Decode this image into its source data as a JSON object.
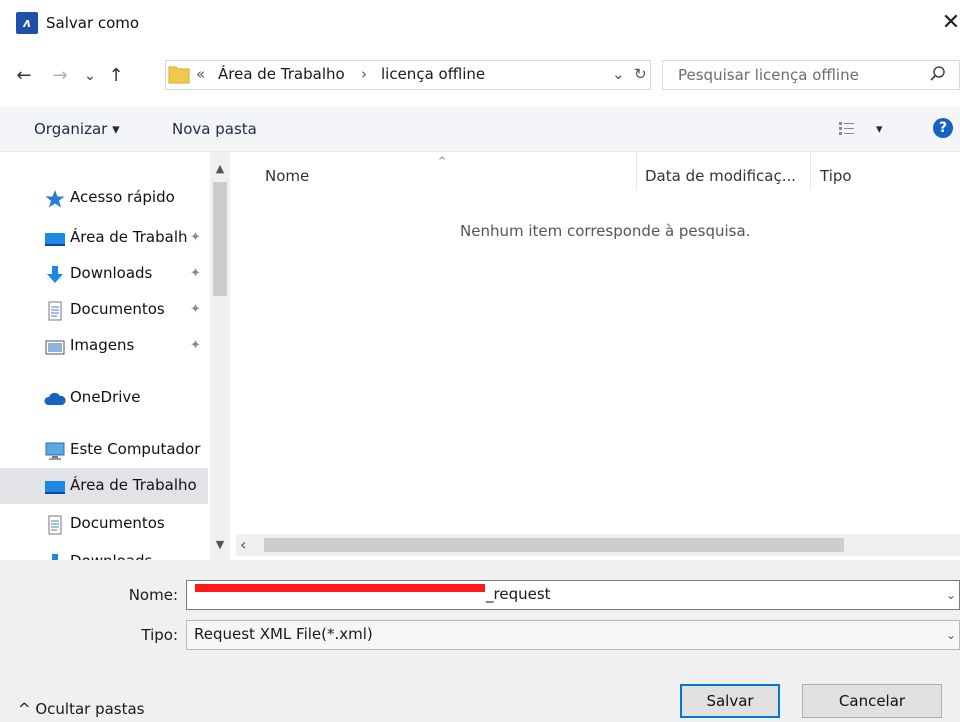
{
  "window": {
    "title": "Salvar como",
    "close_glyph": "✕"
  },
  "nav": {
    "back": "←",
    "forward": "→",
    "recent": "⌄",
    "up": "↑"
  },
  "address": {
    "overflow": "«",
    "crumbs": [
      "Área de Trabalho",
      "licença offline"
    ],
    "separator": "›",
    "dropdown": "⌄",
    "refresh": "↻"
  },
  "search": {
    "placeholder": "Pesquisar licença offline",
    "icon": "search-icon"
  },
  "toolbar": {
    "organize": "Organizar ▾",
    "new_folder": "Nova pasta",
    "view_menu": "▾",
    "help": "?"
  },
  "sidebar": {
    "items": [
      {
        "label": "Acesso rápido",
        "icon": "star-icon"
      },
      {
        "label": "Área de Trabalho",
        "icon": "desktop-icon",
        "pinned": true
      },
      {
        "label": "Downloads",
        "icon": "download-icon",
        "pinned": true
      },
      {
        "label": "Documentos",
        "icon": "documents-icon",
        "pinned": true
      },
      {
        "label": "Imagens",
        "icon": "images-icon",
        "pinned": true
      },
      {
        "label": "OneDrive",
        "icon": "cloud-icon"
      },
      {
        "label": "Este Computador",
        "icon": "computer-icon"
      },
      {
        "label": "Área de Trabalho",
        "icon": "desktop-icon",
        "selected": true
      },
      {
        "label": "Documentos",
        "icon": "documents-icon"
      },
      {
        "label": "Downloads",
        "icon": "download-icon"
      }
    ],
    "pin_glyph": "📌"
  },
  "filelist": {
    "columns": [
      "Nome",
      "Data de modificaç...",
      "Tipo"
    ],
    "empty_message": "Nenhum item corresponde à pesquisa."
  },
  "form": {
    "name_label": "Nome:",
    "name_value": "_request",
    "type_label": "Tipo:",
    "type_value": "Request XML File(*.xml)"
  },
  "footer": {
    "hide_folders": "^ Ocultar pastas",
    "save": "Salvar",
    "cancel": "Cancelar"
  },
  "colors": {
    "accent": "#0078d7",
    "selection": "#e1e3e6",
    "redaction": "#ff1a1a",
    "help": "#1564c0"
  }
}
